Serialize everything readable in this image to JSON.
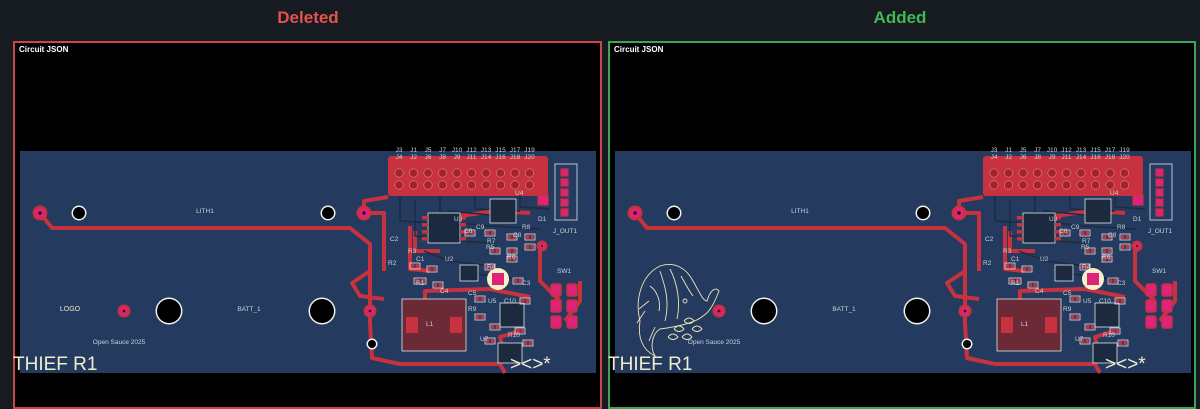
{
  "headings": {
    "deleted": "Deleted",
    "added": "Added"
  },
  "panels": {
    "left": {
      "title": "Circuit JSON"
    },
    "right": {
      "title": "Circuit JSON"
    }
  },
  "board": {
    "lith_label": "LITH1",
    "batt_label": "BATT_1",
    "logo_text": "LOGO",
    "sauce_text": "Open Sauce 2025",
    "board_name": "THIEF R1",
    "marker": "><>*",
    "connector_top": [
      "J3",
      "J1",
      "J5",
      "J7",
      "J10",
      "J12",
      "J13",
      "J15",
      "J17",
      "J19"
    ],
    "connector_bottom": [
      "J4",
      "J2",
      "J6",
      "J8",
      "J9",
      "J11",
      "J14",
      "J16",
      "J18",
      "J20"
    ],
    "component_refs": [
      "U4",
      "U3",
      "D1",
      "J_OUT1",
      "C2",
      "C6",
      "C9",
      "R7",
      "R8",
      "R5",
      "C8",
      "R3",
      "R2",
      "C1",
      "U2",
      "R6",
      "R4",
      "C4",
      "R1",
      "C5",
      "C3",
      "SW1",
      "U5",
      "C10",
      "R9",
      "L1",
      "U7",
      "R10"
    ]
  },
  "colors": {
    "deleted": "#e5534b",
    "added": "#3fb950",
    "copper": "#c8323e",
    "pad": "#e0237a",
    "board": "#243a5e"
  }
}
